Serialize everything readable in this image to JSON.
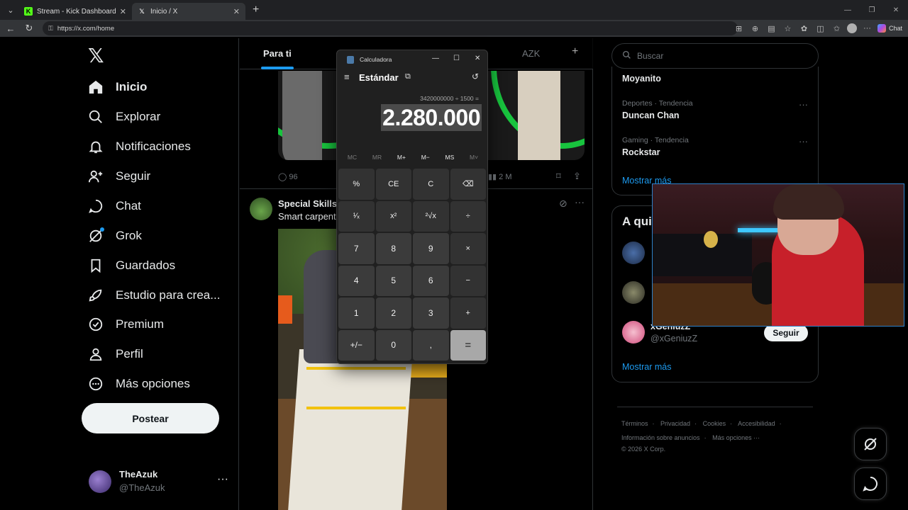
{
  "browser": {
    "tabs": [
      {
        "title": "Stream - Kick Dashboard",
        "active": false,
        "favicon_color": "#53fc18"
      },
      {
        "title": "Inicio / X",
        "active": true,
        "favicon_color": "#ffffff"
      }
    ],
    "url": "https://x.com/home",
    "chat_label": "Chat"
  },
  "x": {
    "nav": [
      {
        "label": "Inicio",
        "icon": "home-icon",
        "active": true
      },
      {
        "label": "Explorar",
        "icon": "search-icon"
      },
      {
        "label": "Notificaciones",
        "icon": "bell-icon"
      },
      {
        "label": "Seguir",
        "icon": "follow-icon"
      },
      {
        "label": "Chat",
        "icon": "chat-icon"
      },
      {
        "label": "Grok",
        "icon": "grok-icon"
      },
      {
        "label": "Guardados",
        "icon": "bookmark-icon"
      },
      {
        "label": "Estudio para crea...",
        "icon": "rocket-icon"
      },
      {
        "label": "Premium",
        "icon": "verified-icon"
      },
      {
        "label": "Perfil",
        "icon": "person-icon"
      },
      {
        "label": "Más opciones",
        "icon": "more-circle-icon"
      }
    ],
    "post_button": "Postear",
    "profile": {
      "name": "TheAzuk",
      "handle": "@TheAzuk"
    },
    "feed_tabs": [
      "Para ti",
      "AZK"
    ],
    "tweet1_actions": {
      "replies": "96",
      "views": "2 M"
    },
    "tweet2": {
      "name": "Special Skills",
      "text": "Smart carpente"
    },
    "search_placeholder": "Buscar",
    "trends": [
      {
        "meta": "",
        "name": "Moyanito"
      },
      {
        "meta": "Deportes · Tendencia",
        "name": "Duncan Chan"
      },
      {
        "meta": "Gaming · Tendencia",
        "name": "Rockstar"
      }
    ],
    "trends_show_more": "Mostrar más",
    "who_to_follow": {
      "title": "A qui",
      "users": [
        {
          "name": "xGeniuzZ",
          "handle": "@xGeniuzZ",
          "button": "Seguir"
        }
      ],
      "show_more": "Mostrar más"
    },
    "footer": {
      "line1": [
        "Términos",
        "·",
        "Privacidad",
        "·",
        "Cookies",
        "·",
        "Accesibilidad",
        "·"
      ],
      "line2": [
        "Información sobre anuncios",
        "·",
        "Más opciones ···"
      ],
      "line3": "© 2026 X Corp."
    }
  },
  "calculator": {
    "title": "Calculadora",
    "mode": "Estándar",
    "expression": "3420000000 ÷ 1500 =",
    "result": "2.280.000",
    "memory": [
      "MC",
      "MR",
      "M+",
      "M−",
      "MS",
      "M˅"
    ],
    "keys": [
      "%",
      "CE",
      "C",
      "⌫",
      "¹⁄ₓ",
      "x²",
      "²√x",
      "÷",
      "7",
      "8",
      "9",
      "×",
      "4",
      "5",
      "6",
      "−",
      "1",
      "2",
      "3",
      "+",
      "+/−",
      "0",
      ",",
      "="
    ]
  }
}
